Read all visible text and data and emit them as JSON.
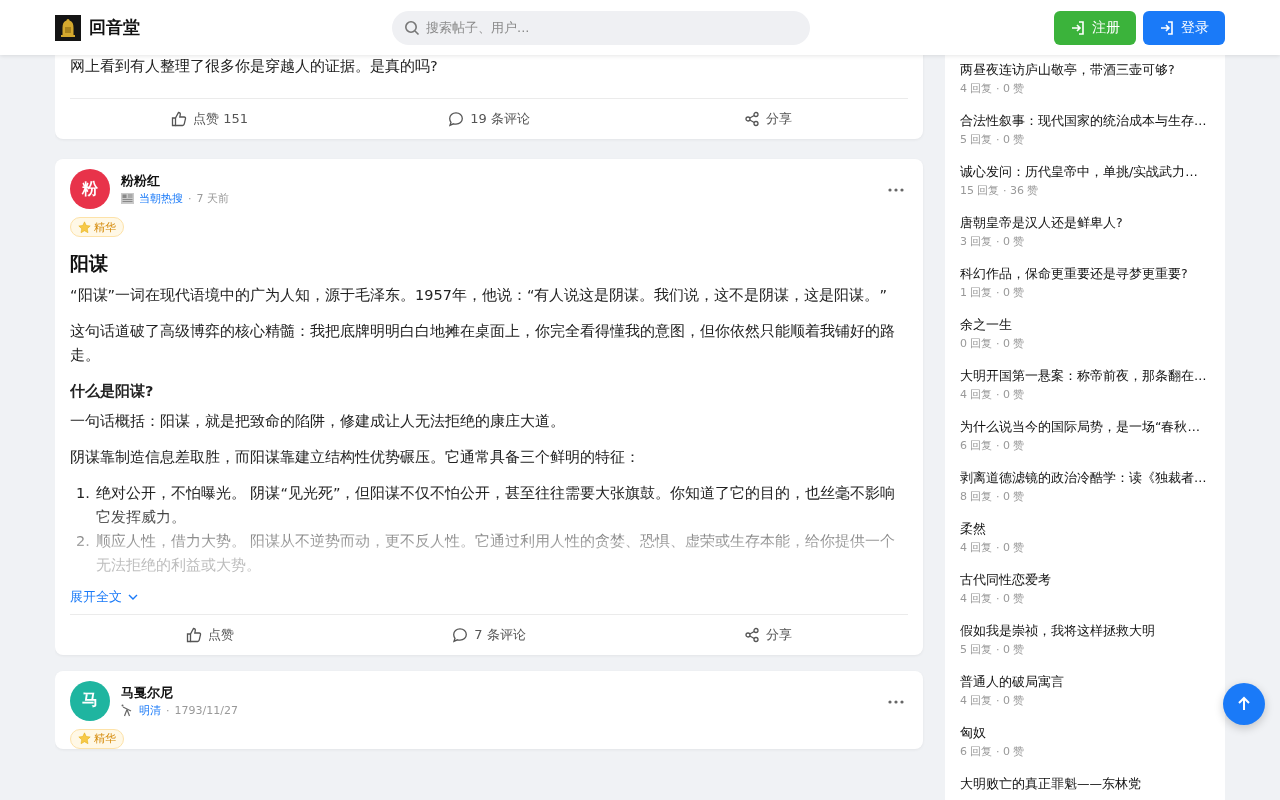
{
  "header": {
    "site_name": "回音堂",
    "search": {
      "placeholder": "搜索帖子、用户..."
    },
    "buttons": [
      {
        "label": "注册",
        "kind": "register"
      },
      {
        "label": "登录",
        "kind": "login"
      }
    ]
  },
  "posts": [
    {
      "blocks": [
        {
          "kind": "p",
          "text": "网上看到有人整理了很多你是穿越人的证据。是真的吗?"
        }
      ],
      "actions": [
        {
          "kind": "like",
          "label": "点赞 151"
        },
        {
          "kind": "comment",
          "label": "19 条评论"
        },
        {
          "kind": "share",
          "label": "分享"
        }
      ]
    },
    {
      "author": {
        "name": "粉粉红",
        "avatar_text": "粉",
        "color": "#e8334a"
      },
      "channel": {
        "kind": "news",
        "label": "当朝热搜"
      },
      "separator": "·",
      "time": "7 天前",
      "badge": "精华",
      "title": "阳谋",
      "collapsed": true,
      "expand_label": "展开全文",
      "blocks": [
        {
          "kind": "p",
          "text": "“阳谋”一词在现代语境中的广为人知，源于毛泽东。1957年，他说：“有人说这是阴谋。我们说，这不是阴谋，这是阳谋。”"
        },
        {
          "kind": "p",
          "text": "这句话道破了高级博弈的核心精髓：我把底牌明明白白地摊在桌面上，你完全看得懂我的意图，但你依然只能顺着我铺好的路走。"
        },
        {
          "kind": "h",
          "text": "什么是阳谋?"
        },
        {
          "kind": "p",
          "text": "一句话概括：阳谋，就是把致命的陷阱，修建成让人无法拒绝的康庄大道。"
        },
        {
          "kind": "p",
          "text": "阴谋靠制造信息差取胜，而阳谋靠建立结构性优势碾压。它通常具备三个鲜明的特征："
        },
        {
          "kind": "ol",
          "items": [
            {
              "number": "1.",
              "text": "绝对公开，不怕曝光。 阴谋“见光死”，但阳谋不仅不怕公开，甚至往往需要大张旗鼓。你知道了它的目的，也丝毫不影响它发挥威力。"
            },
            {
              "number": "2.",
              "text": "顺应人性，借力大势。 阳谋从不逆势而动，更不反人性。它通过利用人性的贪婪、恐惧、虚荣或生存本能，给你提供一个无法拒绝的利益或大势。"
            }
          ]
        }
      ],
      "actions": [
        {
          "kind": "like",
          "label": "点赞"
        },
        {
          "kind": "comment",
          "label": "7 条评论"
        },
        {
          "kind": "share",
          "label": "分享"
        }
      ]
    },
    {
      "author": {
        "name": "马戛尔尼",
        "avatar_text": "马",
        "color": "#1fb5a0"
      },
      "channel": {
        "kind": "telescope",
        "label": "明清"
      },
      "separator": "·",
      "time": "1793/11/27",
      "badge": "精华"
    }
  ],
  "hot_topics": [
    {
      "title": "两昼夜连访庐山敬亭，带酒三壶可够?",
      "meta": "4 回复 · 0 赞"
    },
    {
      "title": "合法性叙事：现代国家的统治成本与生存…",
      "meta": "5 回复 · 0 赞"
    },
    {
      "title": "诚心发问：历代皇帝中，单挑/实战武力…",
      "meta": "15 回复 · 36 赞"
    },
    {
      "title": "唐朝皇帝是汉人还是鲜卑人?",
      "meta": "3 回复 · 0 赞"
    },
    {
      "title": "科幻作品，保命更重要还是寻梦更重要?",
      "meta": "1 回复 · 0 赞"
    },
    {
      "title": "余之一生",
      "meta": "0 回复 · 0 赞"
    },
    {
      "title": "大明开国第一悬案：称帝前夜，那条翻在…",
      "meta": "4 回复 · 0 赞"
    },
    {
      "title": "为什么说当今的国际局势，是一场“春秋…",
      "meta": "6 回复 · 0 赞"
    },
    {
      "title": "剥离道德滤镜的政治冷酷学：读《独裁者…",
      "meta": "8 回复 · 0 赞"
    },
    {
      "title": "柔然",
      "meta": "4 回复 · 0 赞"
    },
    {
      "title": "古代同性恋爱考",
      "meta": "4 回复 · 0 赞"
    },
    {
      "title": "假如我是崇祯，我将这样拯救大明",
      "meta": "5 回复 · 0 赞"
    },
    {
      "title": "普通人的破局寓言",
      "meta": "4 回复 · 0 赞"
    },
    {
      "title": "匈奴",
      "meta": "6 回复 · 0 赞"
    },
    {
      "title": "大明败亡的真正罪魁——东林党"
    }
  ]
}
